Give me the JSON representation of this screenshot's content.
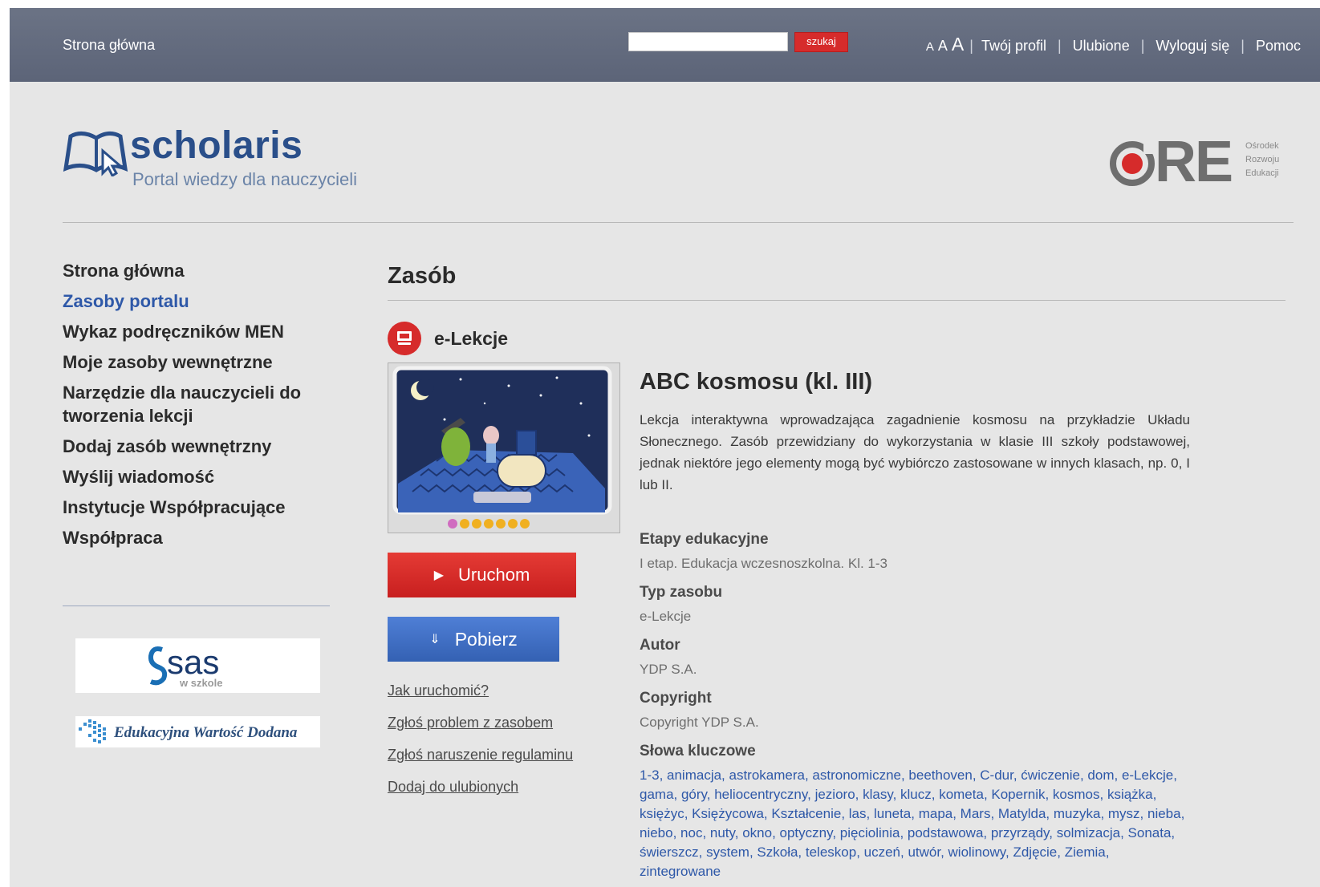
{
  "topbar": {
    "home": "Strona główna",
    "search_placeholder": "",
    "search_button": "szukaj",
    "font_sizes": [
      "A",
      "A",
      "A"
    ],
    "links": [
      "Twój profil",
      "Ulubione",
      "Wyloguj się",
      "Pomoc"
    ],
    "separator": "|"
  },
  "header": {
    "logo_word": "scholaris",
    "logo_tagline": "Portal wiedzy dla nauczycieli",
    "ore_word": "RE",
    "ore_lines": [
      "Ośrodek",
      "Rozwoju",
      "Edukacji"
    ]
  },
  "sidebar": {
    "items": [
      {
        "label": "Strona główna",
        "active": false
      },
      {
        "label": "Zasoby portalu",
        "active": true
      },
      {
        "label": "Wykaz podręczników MEN",
        "active": false
      },
      {
        "label": "Moje zasoby wewnętrzne",
        "active": false
      },
      {
        "label": "Narzędzie dla nauczycieli do tworzenia lekcji",
        "active": false
      },
      {
        "label": "Dodaj zasób wewnętrzny",
        "active": false
      },
      {
        "label": "Wyślij wiadomość",
        "active": false
      },
      {
        "label": "Instytucje Współpracujące",
        "active": false
      },
      {
        "label": "Współpraca",
        "active": false
      }
    ],
    "partners": {
      "sas": "sas",
      "sas_sub": "w szkole",
      "ewd": "Edukacyjna Wartość Dodana"
    }
  },
  "main": {
    "title": "Zasób",
    "category": "e-Lekcje",
    "buttons": {
      "run": "Uruchom",
      "download": "Pobierz"
    },
    "links": [
      "Jak uruchomić?",
      "Zgłoś problem z zasobem",
      "Zgłoś naruszenie regulaminu",
      "Dodaj do ulubionych"
    ],
    "resource": {
      "title": "ABC kosmosu (kl. III)",
      "description": "Lekcja interaktywna wprowadzająca zagadnienie kosmosu na przykładzie Układu Słonecznego. Zasób przewidziany do wykorzystania w klasie III szkoły podstawowej, jednak niektóre jego elementy mogą być wybiórczo zastosowane w innych klasach, np. 0, I lub II.",
      "meta": [
        {
          "label": "Etapy edukacyjne",
          "value": "I etap. Edukacja wczesnoszkolna. Kl. 1-3"
        },
        {
          "label": "Typ zasobu",
          "value": "e-Lekcje"
        },
        {
          "label": "Autor",
          "value": "YDP S.A."
        },
        {
          "label": "Copyright",
          "value": "Copyright YDP S.A."
        }
      ],
      "keywords_label": "Słowa kluczowe",
      "keywords": "1-3, animacja, astrokamera, astronomiczne, beethoven, C-dur, ćwiczenie, dom, e-Lekcje, gama, góry, heliocentryczny, jezioro, klasy, klucz, kometa, Kopernik, kosmos, książka, księżyc, Księżycowa, Kształcenie, las, luneta, mapa, Mars, Matylda, muzyka, mysz, nieba, niebo, noc, nuty, okno, optyczny, pięciolinia, podstawowa, przyrządy, solmizacja, Sonata, świerszcz, system, Szkoła, teleskop, uczeń, utwór, wiolinowy, Zdjęcie, Ziemia, zintegrowane"
    }
  },
  "colors": {
    "topbar": "#636b7e",
    "accent_red": "#d62b2b",
    "link_blue": "#2e58a8",
    "download_blue": "#3d6cc0"
  }
}
